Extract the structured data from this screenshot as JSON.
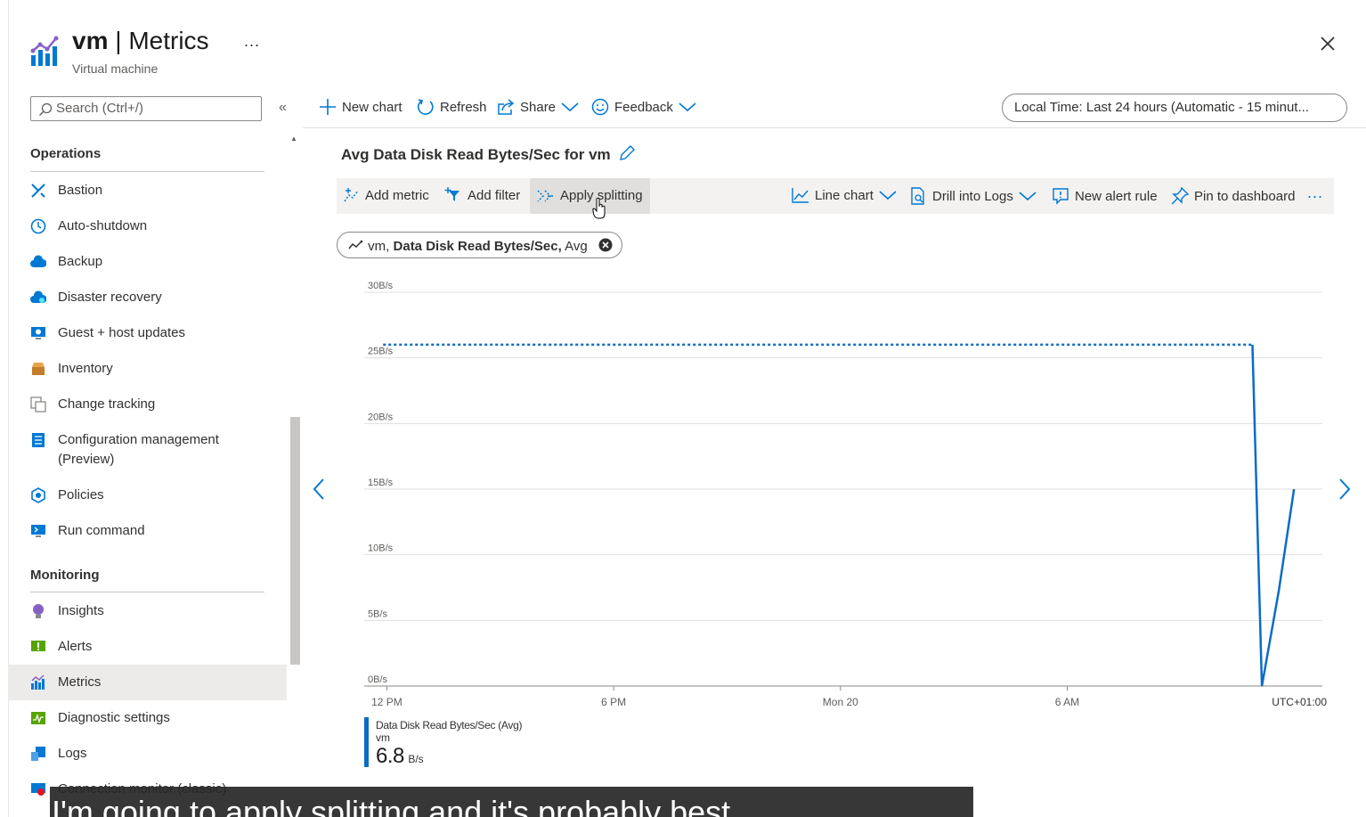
{
  "header": {
    "resource": "vm",
    "separator": "|",
    "page": "Metrics",
    "subtitle": "Virtual machine",
    "more_label": "..."
  },
  "sidebar": {
    "search_placeholder": "Search (Ctrl+/)",
    "collapse_label": "«",
    "sections": [
      {
        "title": "Operations",
        "items": [
          {
            "label": "Bastion",
            "icon": "bastion-icon",
            "color": "#0078d4"
          },
          {
            "label": "Auto-shutdown",
            "icon": "clock-icon",
            "color": "#0078d4"
          },
          {
            "label": "Backup",
            "icon": "backup-cloud-icon",
            "color": "#0078d4"
          },
          {
            "label": "Disaster recovery",
            "icon": "disaster-recovery-icon",
            "color": "#0078d4"
          },
          {
            "label": "Guest + host updates",
            "icon": "updates-icon",
            "color": "#0078d4"
          },
          {
            "label": "Inventory",
            "icon": "inventory-icon",
            "color": "#c47d2c"
          },
          {
            "label": "Change tracking",
            "icon": "change-tracking-icon",
            "color": "#8a8886"
          },
          {
            "label": "Configuration management",
            "label2": "(Preview)",
            "icon": "configuration-icon",
            "color": "#0078d4"
          },
          {
            "label": "Policies",
            "icon": "policies-icon",
            "color": "#0078d4"
          },
          {
            "label": "Run command",
            "icon": "run-command-icon",
            "color": "#0078d4"
          }
        ]
      },
      {
        "title": "Monitoring",
        "items": [
          {
            "label": "Insights",
            "icon": "insights-bulb-icon",
            "color": "#8661c5"
          },
          {
            "label": "Alerts",
            "icon": "alerts-icon",
            "color": "#57a300"
          },
          {
            "label": "Metrics",
            "icon": "metrics-icon",
            "color": "#0078d4",
            "selected": true
          },
          {
            "label": "Diagnostic settings",
            "icon": "diagnostic-icon",
            "color": "#57a300"
          },
          {
            "label": "Logs",
            "icon": "logs-icon",
            "color": "#0078d4"
          },
          {
            "label": "Connection monitor (classic)",
            "icon": "connection-monitor-icon",
            "color": "#0078d4"
          }
        ]
      }
    ]
  },
  "toolbar": {
    "new_chart": "New chart",
    "refresh": "Refresh",
    "share": "Share",
    "feedback": "Feedback",
    "time_range": "Local Time: Last 24 hours (Automatic - 15 minut..."
  },
  "chart_card": {
    "title": "Avg Data Disk Read Bytes/Sec for vm",
    "actions": {
      "add_metric": "Add metric",
      "add_filter": "Add filter",
      "apply_splitting": "Apply splitting",
      "line_chart": "Line chart",
      "drill_logs": "Drill into Logs",
      "new_alert": "New alert rule",
      "pin": "Pin to dashboard",
      "more": "..."
    },
    "metric_pill": {
      "resource": "vm,",
      "metric": "Data Disk Read Bytes/Sec,",
      "aggregation": "Avg"
    },
    "legend": {
      "name": "Data Disk Read Bytes/Sec (Avg)",
      "resource": "vm",
      "value": "6.8",
      "unit": "B/s",
      "color": "#0b6cc6"
    }
  },
  "chart_data": {
    "type": "line",
    "ylabel_ticks": [
      "0B/s",
      "5B/s",
      "10B/s",
      "15B/s",
      "20B/s",
      "25B/s",
      "30B/s"
    ],
    "ylim": [
      0,
      30
    ],
    "x_ticks": [
      "12 PM",
      "6 PM",
      "Mon 20",
      "6 AM"
    ],
    "x_tick_hours": [
      0,
      6,
      12,
      18
    ],
    "timezone_label": "UTC+01:00",
    "grid": true,
    "series": [
      {
        "name": "Data Disk Read Bytes/Sec (Avg)",
        "color": "#0b6cc6",
        "dotted_segment": {
          "x": [
            -0.1,
            22.9
          ],
          "y": [
            26,
            26
          ]
        },
        "solid_segment": {
          "x": [
            22.9,
            23.15,
            23.6,
            24.0
          ],
          "y": [
            26,
            0,
            7.3,
            15
          ]
        }
      }
    ]
  },
  "caption": {
    "text": "I'm going to apply splitting and it's probably best"
  },
  "colors": {
    "accent": "#0078d4",
    "selected_bg": "#edebe9",
    "toolbar_bg": "#f3f2f1"
  }
}
